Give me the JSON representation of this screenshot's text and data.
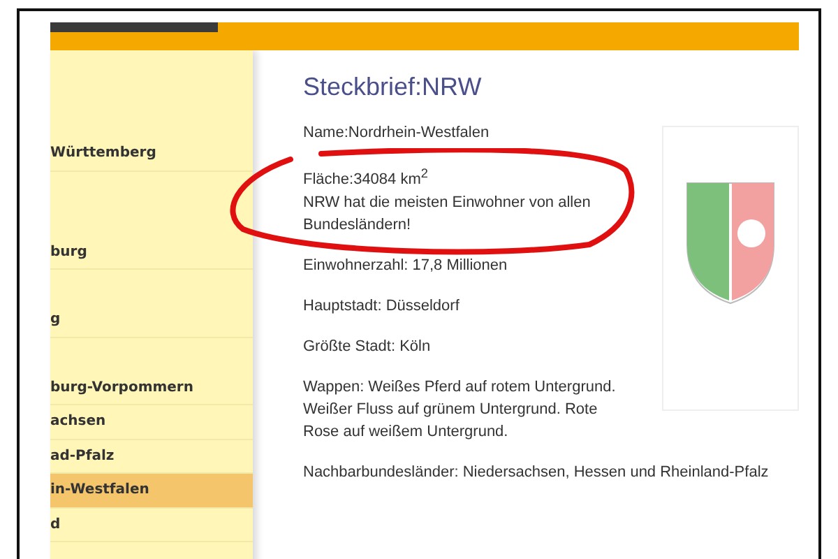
{
  "sidebar": {
    "items": [
      {
        "label": "Württemberg",
        "selected": false
      },
      {
        "label": "burg",
        "selected": false
      },
      {
        "label": "g",
        "selected": false
      },
      {
        "label": "burg-Vorpommern",
        "selected": false
      },
      {
        "label": "achsen",
        "selected": false
      },
      {
        "label": "ad-Pfalz",
        "selected": false
      },
      {
        "label": "in-Westfalen",
        "selected": true
      },
      {
        "label": "d",
        "selected": false
      }
    ]
  },
  "content": {
    "title": "Steckbrief:NRW",
    "paragraphs": [
      "Name:Nordrhein-Westfalen",
      "Fläche:34084 km$^{2}$\nNRW hat die meisten Einwohner von allen\nBundesländern!",
      "Einwohnerzahl: 17,8 Millionen",
      "Hauptstadt: Düsseldorf",
      "Größte Stadt: Köln",
      "Wappen: Weißes Pferd auf rotem Untergrund.\nWeißer Fluss auf grünem Untergrund. Rote\nRose auf weißem Untergrund.",
      "Nachbarbundesländer: Niedersachsen, Hessen und Rheinland-Pfalz"
    ]
  }
}
